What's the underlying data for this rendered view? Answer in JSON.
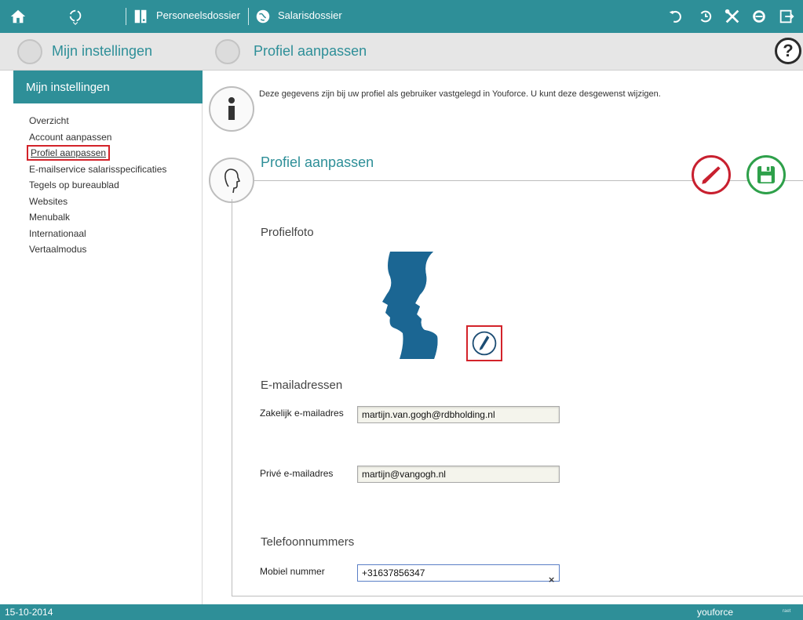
{
  "topbar": {
    "personnel_label": "Personeelsdossier",
    "salary_label": "Salarisdossier"
  },
  "secondbar": {
    "left_title": "Mijn instellingen",
    "right_title": "Profiel aanpassen",
    "help_label": "?"
  },
  "sidebar": {
    "header": "Mijn instellingen",
    "items": [
      {
        "label": "Overzicht"
      },
      {
        "label": "Account aanpassen"
      },
      {
        "label": "Profiel aanpassen"
      },
      {
        "label": "E-mailservice salarisspecificaties"
      },
      {
        "label": "Tegels op bureaublad"
      },
      {
        "label": "Websites"
      },
      {
        "label": "Menubalk"
      },
      {
        "label": "Internationaal"
      },
      {
        "label": "Vertaalmodus"
      }
    ],
    "active_index": 2
  },
  "main": {
    "info_text": "Deze gegevens zijn bij uw profiel als gebruiker vastgelegd in Youforce. U kunt deze desgewenst wijzigen.",
    "section_title": "Profiel aanpassen",
    "photo_heading": "Profielfoto",
    "email_heading": "E-mailadressen",
    "business_email_label": "Zakelijk e-mailadres",
    "business_email_value": "martijn.van.gogh@rdbholding.nl",
    "private_email_label": "Privé e-mailadres",
    "private_email_value": "martijn@vangogh.nl",
    "phone_heading": "Telefoonnummers",
    "mobile_label": "Mobiel nummer",
    "mobile_value": "+31637856347",
    "clear_symbol": "×"
  },
  "footer": {
    "date": "15-10-2014",
    "logo_text": "youforce",
    "small_text": "raet"
  },
  "colors": {
    "accent": "#2e8f98",
    "edit_red": "#c8202f",
    "save_green": "#2ea04a",
    "photo_blue": "#1b6693",
    "highlight_red": "#d3232a"
  },
  "icons": {
    "topbar_left": [
      "home-icon",
      "refresh-circle-icon",
      "binder-icon",
      "globe-icon"
    ],
    "topbar_right": [
      "undo-icon",
      "history-icon",
      "tools-icon",
      "gear-icon",
      "logout-icon"
    ]
  }
}
